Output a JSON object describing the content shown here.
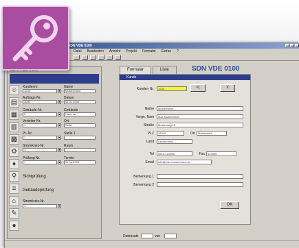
{
  "window": {
    "title": "SDN VDE 0100"
  },
  "menu": {
    "items": [
      "Datei",
      "Bearbeiten",
      "Ansicht",
      "Projekt",
      "Formular",
      "Extras",
      "?"
    ]
  },
  "left_panel": {
    "title": "SDN VDE 0100",
    "header_labels": [
      "Kundennr.",
      "Name"
    ],
    "fields": [
      {
        "label": "Kundennr.",
        "value": "1234",
        "label2": "Name",
        "value2": "Mustermann"
      },
      {
        "label": "Auftrags-Nr.",
        "value": "1000",
        "label2": "Datum",
        "value2": "01.01.2003"
      },
      {
        "label": "Gebäude-Nr.",
        "value": "0",
        "label2": "Gebäude",
        "value2": "Haus 1a"
      },
      {
        "label": "Verteiler-Nr.",
        "value": "1",
        "label2": "Ort",
        "value2": "Keller"
      },
      {
        "label": "Pr.-Nr.",
        "value": "1",
        "label2": "Stelle 1",
        "value2": ""
      },
      {
        "label": "Stromkreis-Nr.",
        "value": "1",
        "label2": "Raum",
        "value2": ""
      },
      {
        "label": "Prüfung Nr.",
        "value": "1",
        "label2": "Termin",
        "value2": "01.01.2004"
      }
    ],
    "links": [
      "Sichtprüfung",
      "Gebäudeprüfung",
      "Stromkreis-Nr."
    ],
    "link_value": "1"
  },
  "tabs": [
    "Formular",
    "Liste"
  ],
  "header_text": "SDN VDE 0100",
  "form": {
    "title": "Kunde",
    "kundennr_label": "Kunden Nr.",
    "kundennr_value": "1234",
    "btn_next": "<|",
    "btn_close": "X",
    "labels": [
      "Name",
      "Vorgn. Nam",
      "Straße",
      "PLZ",
      "Land",
      "Tel",
      "Email",
      "Bemerkung 1",
      "Bemerkung 2"
    ],
    "name": "Mustermann",
    "vorname": "Max Mustermann",
    "strasse": "Musterweg 12",
    "plz": "12345",
    "ort_label": "Ort",
    "ort": "Musterstadt",
    "land": "Deutschland",
    "tel": "0815-123456",
    "fax_label": "Fax",
    "fax": "123456",
    "email": "info@max-mustermann.de",
    "bem1": "",
    "bem2": "",
    "ok_label": "OK"
  },
  "statusbar": {
    "left": "Datensatz",
    "of": "von",
    "count": "1",
    "total": "1"
  },
  "colors": {
    "accent": "#2e3d8c",
    "badge": "#a84da0",
    "highlight": "#f5f53a"
  },
  "icons": [
    "key-icon",
    "user-icon",
    "folder-icon",
    "building-icon",
    "book-icon",
    "calendar-icon",
    "gear-icon",
    "bulb-icon",
    "search-icon",
    "layers-icon",
    "house-icon",
    "tool-icon",
    "camera-icon"
  ]
}
